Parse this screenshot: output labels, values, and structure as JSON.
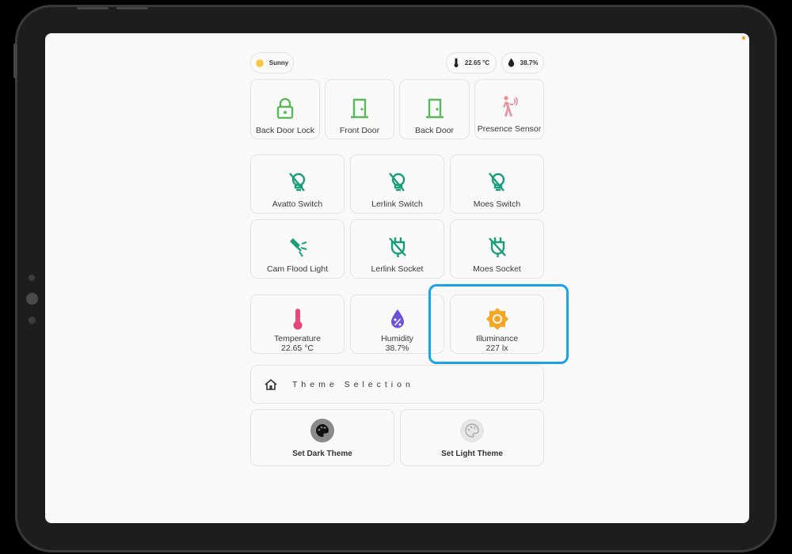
{
  "status": {
    "weather": "Sunny",
    "temperature": "22.65 °C",
    "humidity": "38.7%"
  },
  "doors": [
    {
      "label": "Back Door Lock",
      "icon": "lock-icon"
    },
    {
      "label": "Front Door",
      "icon": "door-icon"
    },
    {
      "label": "Back Door",
      "icon": "door-icon"
    },
    {
      "label": "Presence Sensor",
      "icon": "motion-sensor-icon"
    }
  ],
  "switches": [
    {
      "label": "Avatto Switch",
      "icon": "lightbulb-off-icon"
    },
    {
      "label": "Lerlink Switch",
      "icon": "lightbulb-off-icon"
    },
    {
      "label": "Moes Switch",
      "icon": "lightbulb-off-icon"
    },
    {
      "label": "Cam Flood Light",
      "icon": "flood-light-icon"
    },
    {
      "label": "Lerlink Socket",
      "icon": "power-plug-off-icon"
    },
    {
      "label": "Moes Socket",
      "icon": "power-plug-off-icon"
    }
  ],
  "sensors": [
    {
      "label": "Temperature",
      "value": "22.65 °C",
      "icon": "thermometer-icon"
    },
    {
      "label": "Humidity",
      "value": "38.7%",
      "icon": "water-percent-icon"
    },
    {
      "label": "Illuminance",
      "value": "227 lx",
      "icon": "brightness-icon"
    }
  ],
  "theme": {
    "title": "Theme Selection",
    "dark_label": "Set Dark Theme",
    "light_label": "Set Light Theme"
  },
  "colors": {
    "accent_green": "#5cb85c",
    "switch_teal": "#1a9e7a",
    "presence_pink": "#e8919c",
    "temperature_pink": "#e8467c",
    "humidity_purple": "#6c52d9",
    "illuminance_orange": "#f5a623",
    "highlight_blue": "#1aa3e8"
  }
}
